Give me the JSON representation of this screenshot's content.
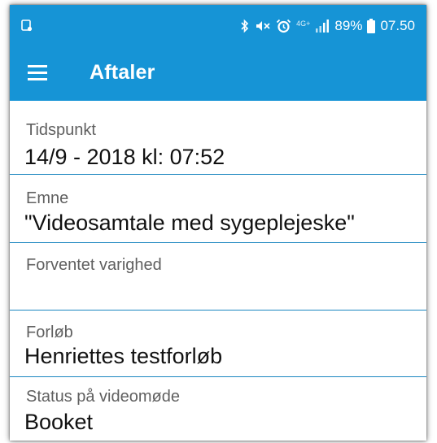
{
  "status_bar": {
    "battery_percent": "89%",
    "time": "07.50",
    "network": "4G+",
    "icons": [
      "notification-icon",
      "bluetooth-icon",
      "mute-icon",
      "alarm-icon",
      "signal-icon",
      "battery-icon"
    ]
  },
  "app_bar": {
    "title": "Aftaler",
    "menu_icon": "hamburger-menu-icon"
  },
  "fields": [
    {
      "label": "Tidspunkt",
      "value": "14/9 - 2018 kl: 07:52"
    },
    {
      "label": "Emne",
      "value": "\"Videosamtale med sygeplejeske\""
    },
    {
      "label": "Forventet varighed",
      "value": ""
    },
    {
      "label": "Forløb",
      "value": "Henriettes testforløb"
    },
    {
      "label": "Status på videomøde",
      "value": "Booket"
    }
  ],
  "colors": {
    "primary": "#1694d6",
    "divider": "#1b86c0",
    "label_text": "#606060",
    "value_text": "#111111"
  }
}
